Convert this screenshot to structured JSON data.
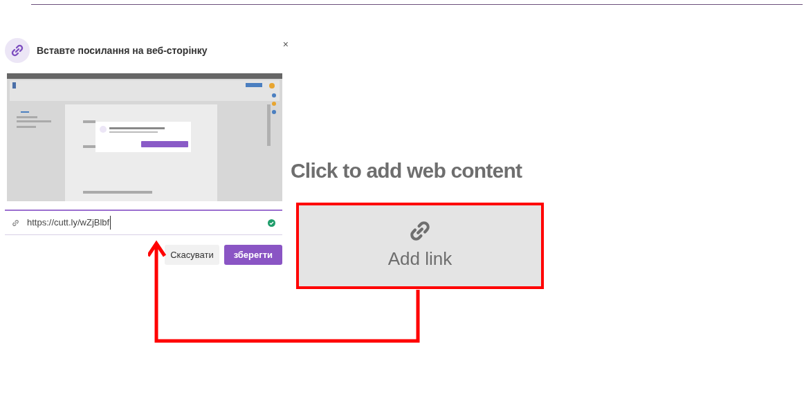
{
  "dialog": {
    "title": "Вставте посилання на веб-сторінку",
    "close": "×",
    "url_field": {
      "value": "https://cutt.ly/wZjBlbf",
      "valid": true
    },
    "buttons": [
      {
        "label": "Скасувати",
        "kind": "secondary"
      },
      {
        "label": "зберегти",
        "kind": "primary"
      }
    ]
  },
  "web_content": {
    "heading": "Click to add web content",
    "add_link": {
      "label": "Add link",
      "highlighted": true
    }
  }
}
